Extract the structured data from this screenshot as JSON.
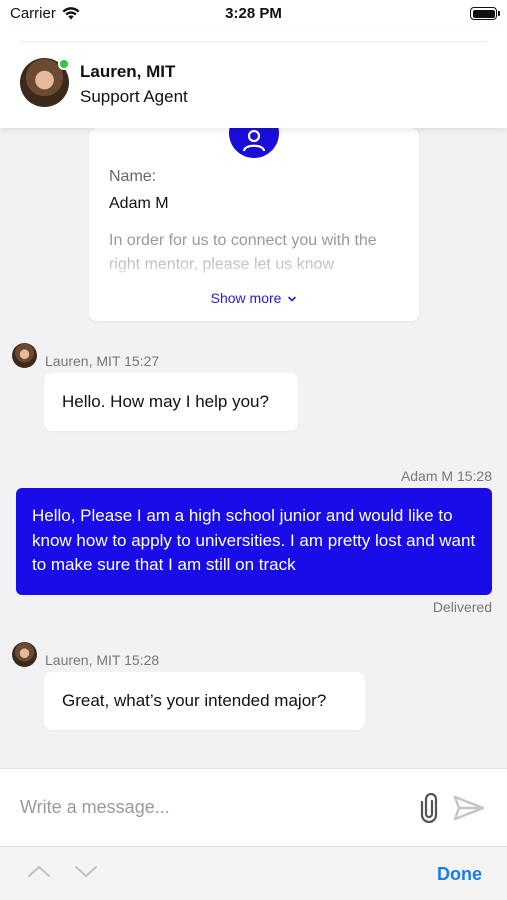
{
  "status_bar": {
    "carrier": "Carrier",
    "time": "3:28 PM",
    "wifi_icon": "wifi-icon",
    "battery_icon": "battery-icon"
  },
  "header": {
    "agent_name": "Lauren, MIT",
    "agent_role": "Support Agent",
    "online": true,
    "online_color": "#28c840"
  },
  "form_card": {
    "icon": "person-icon",
    "name_label": "Name:",
    "name_value": "Adam M",
    "description": "In order for us to connect you with the right mentor, please let us know",
    "show_more": "Show more"
  },
  "messages": [
    {
      "direction": "in",
      "sender_meta": "Lauren, MIT 15:27",
      "text": "Hello. How may I help you?"
    },
    {
      "direction": "out",
      "sender_meta": "Adam M 15:28",
      "text": "Hello, Please I am a high school junior and would like to know how to apply to universities. I am pretty lost and want to make sure that I am still on track",
      "status": "Delivered"
    },
    {
      "direction": "in",
      "sender_meta": "Lauren, MIT 15:28",
      "text": "Great, what’s your intended major?"
    }
  ],
  "composer": {
    "placeholder": "Write a message...",
    "attach_icon": "paperclip-icon",
    "send_icon": "send-icon"
  },
  "keyboard_bar": {
    "prev_icon": "chevron-up-icon",
    "next_icon": "chevron-down-icon",
    "done_label": "Done"
  },
  "colors": {
    "accent": "#1a0ce8",
    "link": "#2a1bd6",
    "done": "#1a7cf0",
    "background": "#f2f2f4"
  }
}
